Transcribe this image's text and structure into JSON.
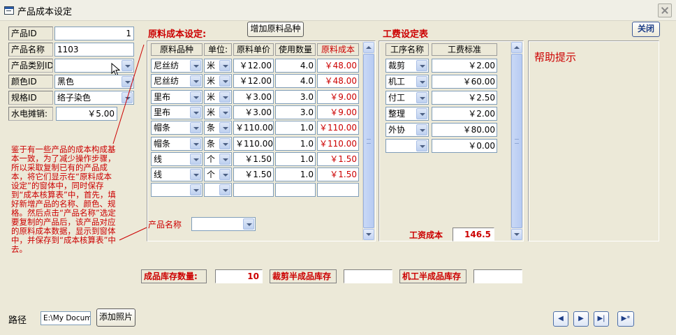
{
  "window": {
    "title": "产品成本设定"
  },
  "fields": {
    "product_id": {
      "label": "产品ID",
      "value": "1"
    },
    "product_name": {
      "label": "产品名称",
      "value": "1103"
    },
    "category_id": {
      "label": "产品类别ID",
      "value": ""
    },
    "color_id": {
      "label": "颜色ID",
      "value": "黑色"
    },
    "spec_id": {
      "label": "规格ID",
      "value": "络子染色"
    },
    "utility": {
      "label": "水电摊销:",
      "value": "￥5.00"
    }
  },
  "note": "鉴于有一些产品的成本构成基本一致，为了减少操作步骤，所以采取复制已有的产品成本，将它们显示在“原料成本设定”的窗体中，同时保存到“成本核算表”中，首先，填好新增产品的名称、颜色、规格。然后点击“产品名称”选定要复制的产品后，该产品对应的原料成本数据，显示到窗体中，并保存到“成本核算表”中去。",
  "material": {
    "title": "原料成本设定:",
    "add_button": "增加原料品种",
    "columns": [
      "原料品种",
      "单位:",
      "原料单价",
      "使用数量",
      "原料成本"
    ],
    "rows": [
      {
        "name": "尼丝纺",
        "unit": "米",
        "price": "￥12.00",
        "qty": "4.0",
        "cost": "￥48.00"
      },
      {
        "name": "尼丝纺",
        "unit": "米",
        "price": "￥12.00",
        "qty": "4.0",
        "cost": "￥48.00"
      },
      {
        "name": "里布",
        "unit": "米",
        "price": "￥3.00",
        "qty": "3.0",
        "cost": "￥9.00"
      },
      {
        "name": "里布",
        "unit": "米",
        "price": "￥3.00",
        "qty": "3.0",
        "cost": "￥9.00"
      },
      {
        "name": "帽条",
        "unit": "条",
        "price": "￥110.00",
        "qty": "1.0",
        "cost": "￥110.00"
      },
      {
        "name": "帽条",
        "unit": "条",
        "price": "￥110.00",
        "qty": "1.0",
        "cost": "￥110.00"
      },
      {
        "name": "线",
        "unit": "个",
        "price": "￥1.50",
        "qty": "1.0",
        "cost": "￥1.50"
      },
      {
        "name": "线",
        "unit": "个",
        "price": "￥1.50",
        "qty": "1.0",
        "cost": "￥1.50"
      },
      {
        "name": "",
        "unit": "",
        "price": "",
        "qty": "",
        "cost": ""
      }
    ],
    "product_name_label": "产品名称",
    "product_name_value": ""
  },
  "labor": {
    "title": "工费设定表",
    "columns": [
      "工序名称",
      "工费标准"
    ],
    "rows": [
      {
        "name": "裁剪",
        "fee": "￥2.00"
      },
      {
        "name": "机工",
        "fee": "￥60.00"
      },
      {
        "name": "付工",
        "fee": "￥2.50"
      },
      {
        "name": "整理",
        "fee": "￥2.00"
      },
      {
        "name": "外协",
        "fee": "￥80.00"
      },
      {
        "name": "",
        "fee": "￥0.00"
      }
    ],
    "total_label": "工资成本",
    "total_value": "146.5"
  },
  "help": {
    "title": "帮助提示"
  },
  "close_button": "关闭",
  "stock": {
    "finished_label": "成品库存数量:",
    "finished_value": "10",
    "cut_label": "裁剪半成品库存",
    "cut_value": "",
    "machine_label": "机工半成品库存",
    "machine_value": ""
  },
  "path": {
    "label": "路径",
    "value": "E:\\My Documents",
    "add_photo": "添加照片"
  },
  "nav": {
    "first": "◀",
    "next": "▶",
    "last": "▶|",
    "new": "▶*"
  }
}
